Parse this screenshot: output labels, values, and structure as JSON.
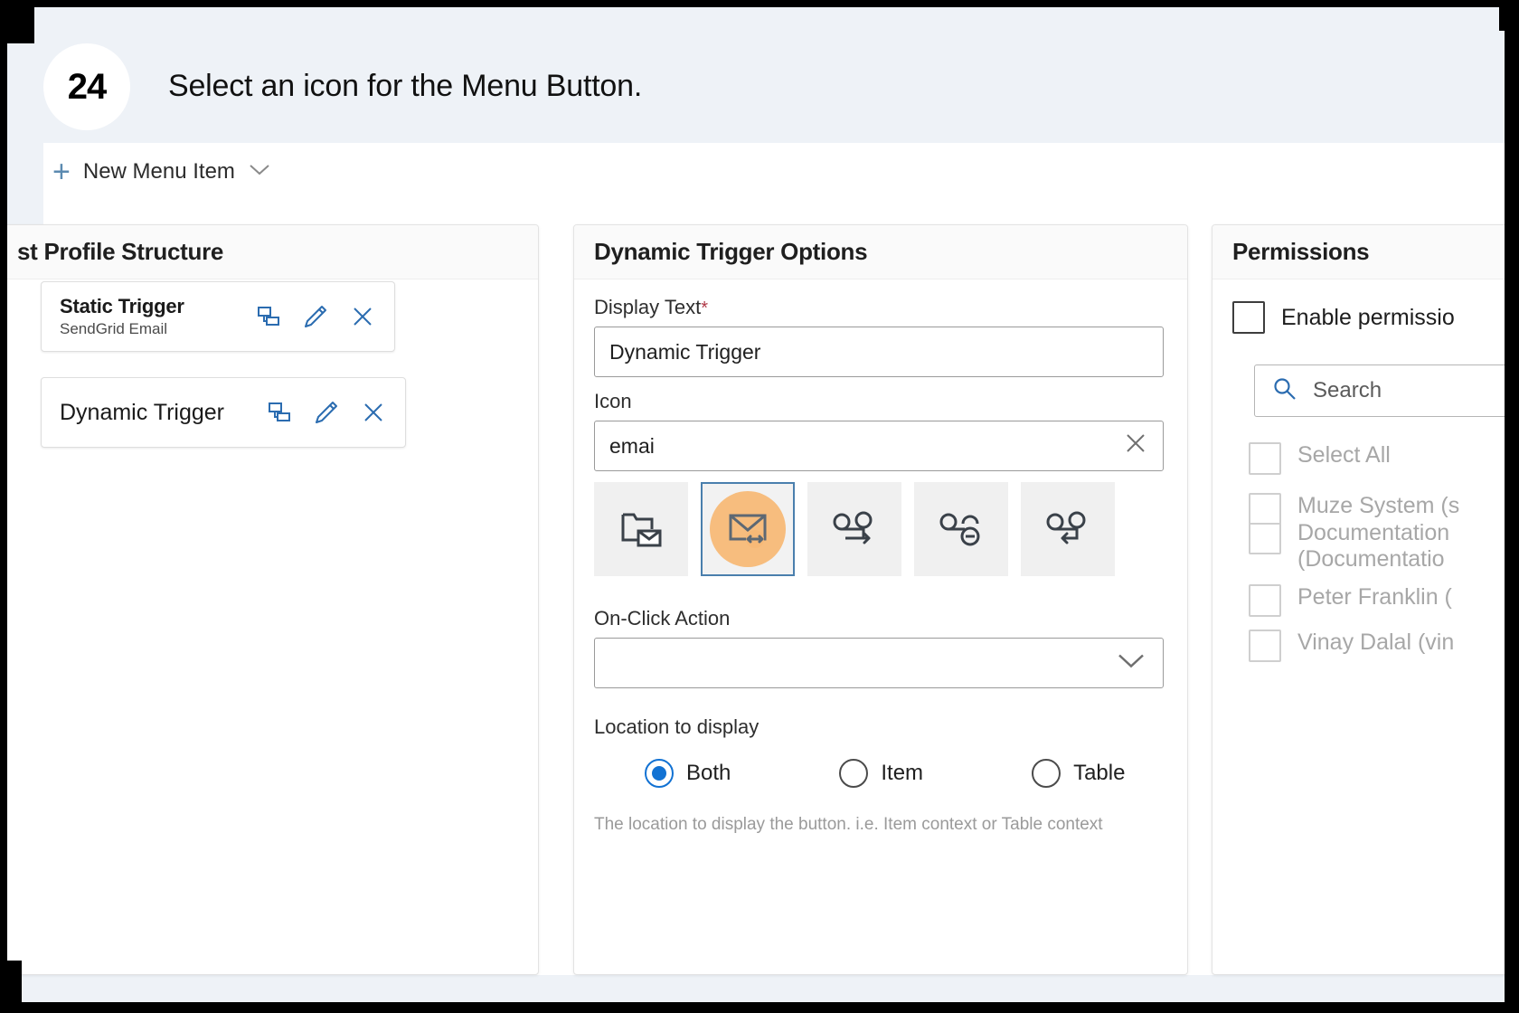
{
  "step": {
    "number": "24",
    "instruction": "Select an icon for the Menu Button."
  },
  "menubar": {
    "new_menu_item_label": "New Menu Item",
    "plus_icon": "plus-icon",
    "chevron_icon": "chevron-down-icon"
  },
  "left_panel": {
    "title": "st Profile Structure",
    "triggers": [
      {
        "name": "Static Trigger",
        "subtitle": "SendGrid Email",
        "actions": [
          "copy-icon",
          "edit-icon",
          "delete-icon"
        ]
      },
      {
        "name": "Dynamic Trigger",
        "subtitle": "",
        "actions": [
          "copy-icon",
          "edit-icon",
          "delete-icon"
        ]
      }
    ]
  },
  "center_panel": {
    "title": "Dynamic Trigger Options",
    "display_text": {
      "label": "Display Text",
      "required_marker": "*",
      "value": "Dynamic Trigger",
      "placeholder": ""
    },
    "icon_field": {
      "label": "Icon",
      "value": "emai",
      "placeholder": "",
      "clear_icon": "close-icon"
    },
    "icon_results": [
      {
        "name": "email-folder-icon",
        "selected": false
      },
      {
        "name": "email-exchange-icon",
        "selected": true
      },
      {
        "name": "email-forward-icon",
        "selected": false
      },
      {
        "name": "email-remove-icon",
        "selected": false
      },
      {
        "name": "email-reply-icon",
        "selected": false
      }
    ],
    "on_click_action": {
      "label": "On-Click Action",
      "value": "",
      "chevron_icon": "chevron-down-icon"
    },
    "location_to_display": {
      "label": "Location to display",
      "options": [
        {
          "label": "Both",
          "selected": true
        },
        {
          "label": "Item",
          "selected": false
        },
        {
          "label": "Table",
          "selected": false
        }
      ],
      "help_text": "The location to display the button. i.e. Item context or Table context"
    }
  },
  "right_panel": {
    "title": "Permissions",
    "enable_permissions_label": "Enable permissio",
    "enable_permissions_checked": false,
    "search": {
      "placeholder": "Search",
      "icon": "search-icon",
      "value": ""
    },
    "select_all_label": "Select All",
    "items": [
      {
        "lines": [
          "Muze System (s",
          "Documentation",
          "(Documentatio"
        ],
        "checked": false,
        "tall": true
      },
      {
        "lines": [
          "Peter Franklin ("
        ],
        "checked": false,
        "tall": false
      },
      {
        "lines": [
          "Vinay Dalal (vin"
        ],
        "checked": false,
        "tall": false
      }
    ]
  },
  "colors": {
    "accent_blue": "#2b6cb0",
    "selected_highlight": "#f7b977",
    "radio_blue": "#1272d3",
    "page_bg": "#eef2f7",
    "required_red": "#b03a48"
  }
}
